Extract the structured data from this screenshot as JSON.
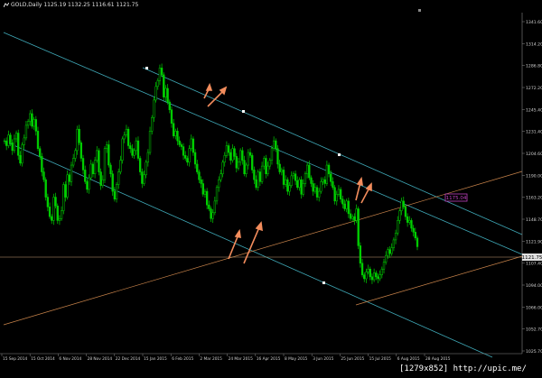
{
  "chart_data": {
    "type": "line",
    "title": "GOLD,Daily  1125.19 1132.25 1116.61 1121.75",
    "symbol": "GOLD",
    "timeframe": "Daily",
    "ohlc": {
      "open": 1125.19,
      "high": 1132.25,
      "low": 1116.61,
      "close": 1121.75
    },
    "ylim": [
      1010.9,
      1362.0
    ],
    "y_ticks": [
      "1341.60",
      "1314.20",
      "1286.80",
      "1272.20",
      "1245.40",
      "1231.40",
      "1204.60",
      "1190.00",
      "1163.20",
      "1148.70",
      "1121.90",
      "1107.40",
      "1094.00",
      "1066.00",
      "1052.70",
      "1025.70"
    ],
    "x_ticks": [
      "15 Sep 2014",
      "15 Oct 2014",
      "6 Nov 2014",
      "28 Nov 2014",
      "22 Dec 2014",
      "15 Jan 2015",
      "6 Feb 2015",
      "2 Mar 2015",
      "24 Mar 2015",
      "16 Apr 2015",
      "8 May 2015",
      "3 Jun 2015",
      "25 Jun 2015",
      "15 Jul 2015",
      "6 Aug 2015",
      "28 Aug 2015"
    ],
    "price_label": "1121.75",
    "marker_label": "1175.04",
    "series": [
      {
        "values": [
          1230,
          1225,
          1236,
          1228,
          1220,
          1232,
          1238,
          1215,
          1207,
          1226,
          1233,
          1246,
          1250,
          1258,
          1245,
          1252,
          1240,
          1222,
          1214,
          1198,
          1190,
          1172,
          1162,
          1152,
          1148,
          1172,
          1163,
          1148,
          1150,
          1158,
          1185,
          1172,
          1195,
          1188,
          1205,
          1212,
          1220,
          1242,
          1228,
          1212,
          1200,
          1188,
          1180,
          1192,
          1206,
          1196,
          1210,
          1220,
          1198,
          1184,
          1190,
          1222,
          1226,
          1205,
          1196,
          1178,
          1170,
          1185,
          1198,
          1210,
          1232,
          1236,
          1242,
          1225,
          1222,
          1215,
          1220,
          1230,
          1212,
          1198,
          1186,
          1195,
          1208,
          1218,
          1240,
          1254,
          1272,
          1286,
          1292,
          1305,
          1298,
          1275,
          1284,
          1270,
          1262,
          1248,
          1235,
          1240,
          1230,
          1226,
          1224,
          1215,
          1212,
          1208,
          1222,
          1232,
          1218,
          1206,
          1198,
          1190,
          1186,
          1175,
          1178,
          1164,
          1160,
          1150,
          1156,
          1168,
          1182,
          1190,
          1196,
          1208,
          1215,
          1225,
          1218,
          1210,
          1222,
          1214,
          1202,
          1208,
          1220,
          1210,
          1196,
          1205,
          1218,
          1215,
          1200,
          1190,
          1182,
          1198,
          1188,
          1204,
          1212,
          1196,
          1204,
          1210,
          1222,
          1230,
          1222,
          1206,
          1198,
          1200,
          1185,
          1190,
          1178,
          1184,
          1194,
          1196,
          1189,
          1182,
          1190,
          1175,
          1186,
          1196,
          1205,
          1192,
          1186,
          1178,
          1182,
          1172,
          1178,
          1188,
          1190,
          1186,
          1205,
          1196,
          1188,
          1182,
          1168,
          1175,
          1180,
          1170,
          1165,
          1160,
          1168,
          1155,
          1150,
          1152,
          1148,
          1160,
          1122,
          1104,
          1092,
          1088,
          1095,
          1098,
          1090,
          1087,
          1094,
          1090,
          1088,
          1092,
          1098,
          1105,
          1112,
          1118,
          1114,
          1120,
          1128,
          1135,
          1148,
          1158,
          1168,
          1162,
          1152,
          1146,
          1148,
          1140,
          1136,
          1130,
          1121
        ]
      }
    ]
  }
}
